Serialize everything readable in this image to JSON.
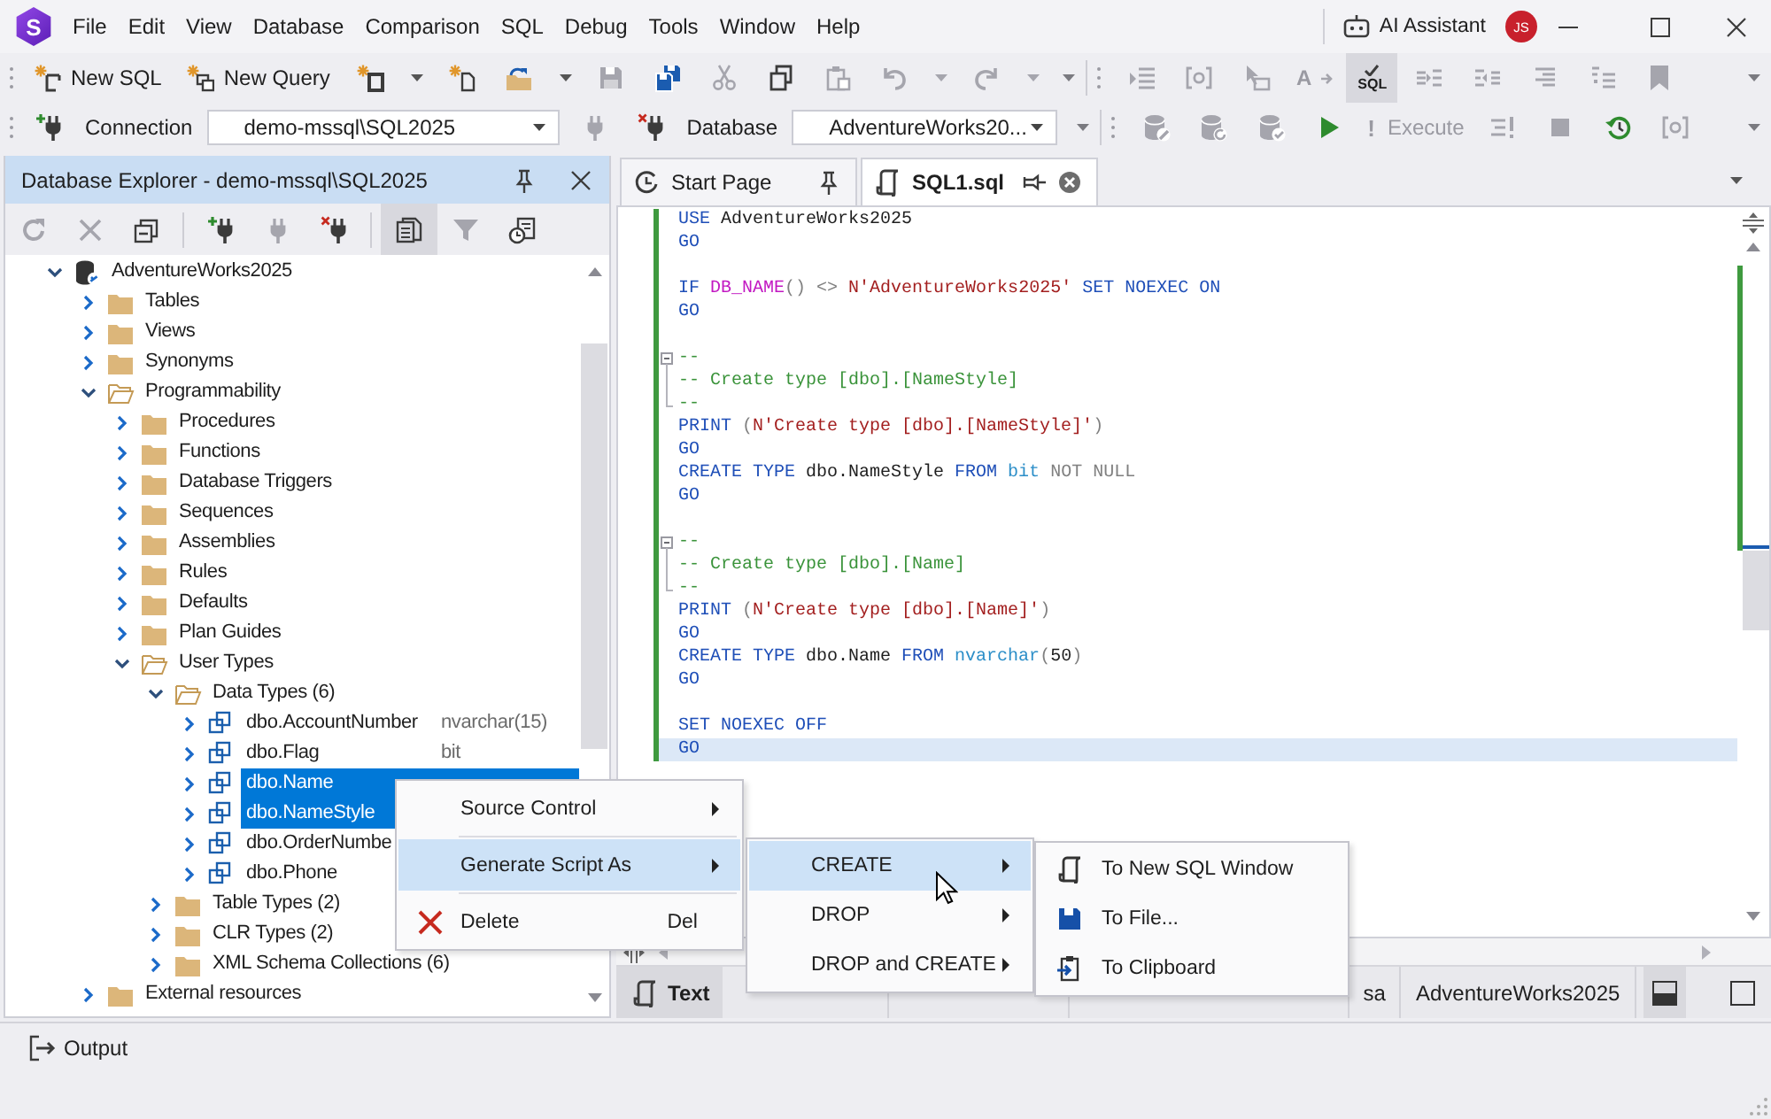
{
  "app": {
    "logo_text": "S"
  },
  "menu_bar": {
    "items": [
      "File",
      "Edit",
      "View",
      "Database",
      "Comparison",
      "SQL",
      "Debug",
      "Tools",
      "Window",
      "Help"
    ],
    "ai_assistant": "AI Assistant",
    "avatar_initials": "JS"
  },
  "toolbar_standard": {
    "items": [
      {
        "kind": "button",
        "label": "New SQL",
        "disabled": false,
        "pressed": false
      },
      {
        "kind": "button",
        "label": "New Query",
        "disabled": false,
        "pressed": false
      },
      {
        "kind": "split",
        "disabled": false,
        "pressed": false
      },
      {
        "kind": "button",
        "disabled": false,
        "pressed": false
      },
      {
        "kind": "split",
        "disabled": false,
        "pressed": false
      },
      {
        "kind": "button",
        "disabled": true,
        "pressed": false
      },
      {
        "kind": "button",
        "disabled": false,
        "pressed": false
      },
      {
        "kind": "button",
        "disabled": true,
        "pressed": false
      },
      {
        "kind": "button",
        "disabled": false,
        "pressed": false
      },
      {
        "kind": "button",
        "disabled": true,
        "pressed": false
      },
      {
        "kind": "split",
        "disabled": true,
        "pressed": false
      },
      {
        "kind": "split",
        "disabled": true,
        "pressed": false
      },
      {
        "kind": "overflow"
      }
    ]
  },
  "toolbar_editor": {
    "items": [
      {
        "kind": "button",
        "disabled": true,
        "pressed": false
      },
      {
        "kind": "button",
        "disabled": true,
        "pressed": false
      },
      {
        "kind": "button",
        "disabled": true,
        "pressed": false
      },
      {
        "kind": "button",
        "icon_text": "A",
        "disabled": true,
        "pressed": false
      },
      {
        "kind": "button",
        "icon_text": "SQL",
        "disabled": false,
        "pressed": true
      },
      {
        "kind": "button",
        "disabled": true,
        "pressed": false
      },
      {
        "kind": "button",
        "disabled": true,
        "pressed": false
      },
      {
        "kind": "button",
        "disabled": true,
        "pressed": false
      },
      {
        "kind": "button",
        "disabled": true,
        "pressed": false
      },
      {
        "kind": "button",
        "disabled": true,
        "pressed": false
      },
      {
        "kind": "overflow"
      }
    ]
  },
  "toolbar_connection": {
    "items": [
      {
        "kind": "button",
        "disabled": false,
        "pressed": false
      },
      {
        "kind": "label",
        "label": "Connection"
      },
      {
        "kind": "combo",
        "value": "demo-mssql\\SQL2025"
      },
      {
        "kind": "button",
        "disabled": true,
        "pressed": false
      },
      {
        "kind": "button",
        "disabled": false,
        "pressed": false
      },
      {
        "kind": "label",
        "label": "Database"
      },
      {
        "kind": "combo",
        "value": "AdventureWorks20..."
      },
      {
        "kind": "overflow"
      }
    ]
  },
  "toolbar_execute": {
    "items": [
      {
        "kind": "button",
        "disabled": true,
        "pressed": false
      },
      {
        "kind": "button",
        "disabled": true,
        "pressed": false
      },
      {
        "kind": "button",
        "disabled": true,
        "pressed": false
      },
      {
        "kind": "button",
        "disabled": false,
        "pressed": false
      },
      {
        "kind": "button",
        "icon_text": "!",
        "label": "Execute",
        "disabled": true,
        "pressed": false
      },
      {
        "kind": "button",
        "disabled": true,
        "pressed": false
      },
      {
        "kind": "button",
        "disabled": true,
        "pressed": false
      },
      {
        "kind": "button",
        "disabled": false,
        "pressed": false
      },
      {
        "kind": "button",
        "disabled": true,
        "pressed": false
      },
      {
        "kind": "overflow"
      }
    ]
  },
  "explorer": {
    "title": "Database Explorer - demo-mssql\\SQL2025",
    "toolbar": [
      {
        "disabled": true,
        "pressed": false
      },
      {
        "disabled": true,
        "pressed": false
      },
      {
        "disabled": false,
        "pressed": false
      },
      {
        "disabled": false,
        "pressed": false
      },
      {
        "disabled": true,
        "pressed": false
      },
      {
        "disabled": false,
        "pressed": false
      },
      {
        "disabled": false,
        "pressed": true
      },
      {
        "disabled": true,
        "pressed": false
      },
      {
        "disabled": false,
        "pressed": false
      }
    ],
    "tree": [
      {
        "kind": "database",
        "label": "AdventureWorks2025",
        "expanded": true,
        "selected": false,
        "children": [
          {
            "kind": "folder",
            "label": "Tables",
            "expanded": false,
            "selected": false
          },
          {
            "kind": "folder",
            "label": "Views",
            "expanded": false,
            "selected": false
          },
          {
            "kind": "folder",
            "label": "Synonyms",
            "expanded": false,
            "selected": false
          },
          {
            "kind": "folder",
            "label": "Programmability",
            "expanded": true,
            "selected": false,
            "children": [
              {
                "kind": "folder",
                "label": "Procedures",
                "expanded": false,
                "selected": false
              },
              {
                "kind": "folder",
                "label": "Functions",
                "expanded": false,
                "selected": false
              },
              {
                "kind": "folder",
                "label": "Database Triggers",
                "expanded": false,
                "selected": false
              },
              {
                "kind": "folder",
                "label": "Sequences",
                "expanded": false,
                "selected": false
              },
              {
                "kind": "folder",
                "label": "Assemblies",
                "expanded": false,
                "selected": false
              },
              {
                "kind": "folder",
                "label": "Rules",
                "expanded": false,
                "selected": false
              },
              {
                "kind": "folder",
                "label": "Defaults",
                "expanded": false,
                "selected": false
              },
              {
                "kind": "folder",
                "label": "Plan Guides",
                "expanded": false,
                "selected": false
              },
              {
                "kind": "folder",
                "label": "User Types",
                "expanded": true,
                "selected": false,
                "children": [
                  {
                    "kind": "folder",
                    "label": "Data Types (6)",
                    "expanded": true,
                    "selected": false,
                    "children": [
                      {
                        "kind": "type",
                        "label": "dbo.AccountNumber",
                        "data_type": "nvarchar(15)",
                        "expanded": false,
                        "selected": false
                      },
                      {
                        "kind": "type",
                        "label": "dbo.Flag",
                        "data_type": "bit",
                        "expanded": false,
                        "selected": false
                      },
                      {
                        "kind": "type",
                        "label": "dbo.Name",
                        "expanded": false,
                        "selected": true
                      },
                      {
                        "kind": "type",
                        "label": "dbo.NameStyle",
                        "expanded": false,
                        "selected": true
                      },
                      {
                        "kind": "type",
                        "label": "dbo.OrderNumbe",
                        "expanded": false,
                        "selected": false
                      },
                      {
                        "kind": "type",
                        "label": "dbo.Phone",
                        "expanded": false,
                        "selected": false
                      }
                    ]
                  },
                  {
                    "kind": "folder",
                    "label": "Table Types (2)",
                    "expanded": false,
                    "selected": false
                  },
                  {
                    "kind": "folder",
                    "label": "CLR Types (2)",
                    "expanded": false,
                    "selected": false
                  },
                  {
                    "kind": "folder",
                    "label": "XML Schema Collections (6)",
                    "expanded": false,
                    "selected": false
                  }
                ]
              }
            ]
          },
          {
            "kind": "folder",
            "label": "External resources",
            "expanded": false,
            "selected": false
          }
        ]
      }
    ]
  },
  "editor": {
    "tabs": [
      {
        "label": "Start Page",
        "selected": false,
        "pinned": true
      },
      {
        "label": "SQL1.sql",
        "selected": true,
        "pinned": false
      }
    ],
    "lines": [
      {
        "kind": "code",
        "current": false,
        "tokens": [
          {
            "kind": "keyword",
            "text": "USE"
          },
          {
            "kind": "plain",
            "text": " AdventureWorks2025"
          }
        ]
      },
      {
        "kind": "code",
        "current": false,
        "tokens": [
          {
            "kind": "keyword",
            "text": "GO"
          }
        ]
      },
      {
        "kind": "blank",
        "current": false
      },
      {
        "kind": "code",
        "current": false,
        "tokens": [
          {
            "kind": "keyword",
            "text": "IF "
          },
          {
            "kind": "function",
            "text": "DB_NAME"
          },
          {
            "kind": "operator",
            "text": "() <> "
          },
          {
            "kind": "string",
            "text": "N'AdventureWorks2025'"
          },
          {
            "kind": "keyword",
            "text": " SET NOEXEC ON"
          }
        ]
      },
      {
        "kind": "code",
        "current": false,
        "tokens": [
          {
            "kind": "keyword",
            "text": "GO"
          }
        ]
      },
      {
        "kind": "blank",
        "current": false
      },
      {
        "kind": "fold",
        "current": false,
        "tokens": [
          {
            "kind": "comment",
            "text": "--"
          }
        ]
      },
      {
        "kind": "code",
        "current": false,
        "tokens": [
          {
            "kind": "comment",
            "text": "-- Create type [dbo].[NameStyle]"
          }
        ]
      },
      {
        "kind": "code",
        "current": false,
        "tokens": [
          {
            "kind": "comment",
            "text": "--"
          }
        ]
      },
      {
        "kind": "code",
        "current": false,
        "tokens": [
          {
            "kind": "keyword",
            "text": "PRINT "
          },
          {
            "kind": "operator",
            "text": "("
          },
          {
            "kind": "string",
            "text": "N'Create type [dbo].[NameStyle]'"
          },
          {
            "kind": "operator",
            "text": ")"
          }
        ]
      },
      {
        "kind": "code",
        "current": false,
        "tokens": [
          {
            "kind": "keyword",
            "text": "GO"
          }
        ]
      },
      {
        "kind": "code",
        "current": false,
        "tokens": [
          {
            "kind": "keyword",
            "text": "CREATE TYPE "
          },
          {
            "kind": "plain",
            "text": "dbo.NameStyle "
          },
          {
            "kind": "keyword",
            "text": "FROM "
          },
          {
            "kind": "datatype",
            "text": "bit "
          },
          {
            "kind": "operator",
            "text": "NOT NULL"
          }
        ]
      },
      {
        "kind": "code",
        "current": false,
        "tokens": [
          {
            "kind": "keyword",
            "text": "GO"
          }
        ]
      },
      {
        "kind": "blank",
        "current": false
      },
      {
        "kind": "fold",
        "current": false,
        "tokens": [
          {
            "kind": "comment",
            "text": "--"
          }
        ]
      },
      {
        "kind": "code",
        "current": false,
        "tokens": [
          {
            "kind": "comment",
            "text": "-- Create type [dbo].[Name]"
          }
        ]
      },
      {
        "kind": "code",
        "current": false,
        "tokens": [
          {
            "kind": "comment",
            "text": "--"
          }
        ]
      },
      {
        "kind": "code",
        "current": false,
        "tokens": [
          {
            "kind": "keyword",
            "text": "PRINT "
          },
          {
            "kind": "operator",
            "text": "("
          },
          {
            "kind": "string",
            "text": "N'Create type [dbo].[Name]'"
          },
          {
            "kind": "operator",
            "text": ")"
          }
        ]
      },
      {
        "kind": "code",
        "current": false,
        "tokens": [
          {
            "kind": "keyword",
            "text": "GO"
          }
        ]
      },
      {
        "kind": "code",
        "current": false,
        "tokens": [
          {
            "kind": "keyword",
            "text": "CREATE TYPE "
          },
          {
            "kind": "plain",
            "text": "dbo.Name "
          },
          {
            "kind": "keyword",
            "text": "FROM "
          },
          {
            "kind": "datatype",
            "text": "nvarchar"
          },
          {
            "kind": "operator",
            "text": "("
          },
          {
            "kind": "number",
            "text": "50"
          },
          {
            "kind": "operator",
            "text": ")"
          }
        ]
      },
      {
        "kind": "code",
        "current": false,
        "tokens": [
          {
            "kind": "keyword",
            "text": "GO"
          }
        ]
      },
      {
        "kind": "blank",
        "current": false
      },
      {
        "kind": "code",
        "current": false,
        "tokens": [
          {
            "kind": "keyword",
            "text": "SET NOEXEC OFF"
          }
        ]
      },
      {
        "kind": "code",
        "current": true,
        "tokens": [
          {
            "kind": "keyword",
            "text": "GO"
          }
        ]
      }
    ]
  },
  "results_bar": {
    "tabs": [
      {
        "label": "Text",
        "selected": true
      }
    ],
    "user": "sa",
    "database": "AdventureWorks2025",
    "layout_buttons": [
      {
        "selected": true
      },
      {
        "selected": false
      }
    ]
  },
  "output_panel": {
    "label": "Output"
  },
  "context_menu": {
    "items": [
      {
        "kind": "submenu",
        "label": "Source Control",
        "selected": false
      },
      {
        "kind": "submenu",
        "label": "Generate Script As",
        "selected": true
      },
      {
        "kind": "command",
        "label": "Delete",
        "shortcut": "Del",
        "selected": false
      }
    ]
  },
  "script_menu": {
    "items": [
      {
        "kind": "submenu",
        "label": "CREATE",
        "selected": true
      },
      {
        "kind": "submenu",
        "label": "DROP",
        "selected": false
      },
      {
        "kind": "submenu",
        "label": "DROP and CREATE",
        "selected": false
      }
    ]
  },
  "target_menu": {
    "items": [
      {
        "label": "To New SQL Window"
      },
      {
        "label": "To File..."
      },
      {
        "label": "To Clipboard"
      }
    ]
  }
}
